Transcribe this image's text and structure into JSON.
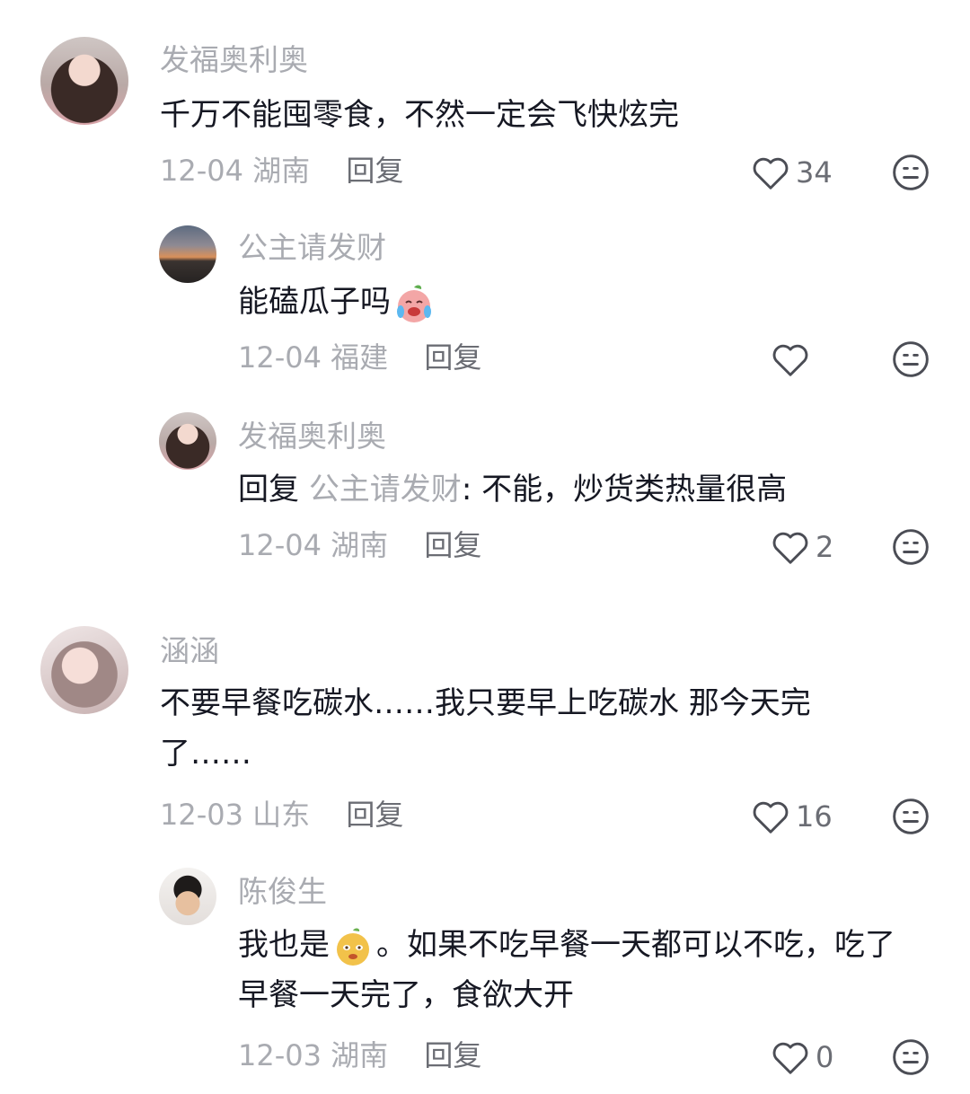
{
  "comments": [
    {
      "name": "发福奥利奥",
      "text": "千万不能囤零食，不然一定会飞快炫完",
      "date": "12-04",
      "location": "湖南",
      "reply_label": "回复",
      "likes": "34"
    },
    {
      "name": "公主请发财",
      "text": "能磕瓜子吗",
      "emoji": "laughing-tears-emoji",
      "date": "12-04",
      "location": "福建",
      "reply_label": "回复",
      "likes": ""
    },
    {
      "name": "发福奥利奥",
      "reply_prefix": "回复 ",
      "mention": "公主请发财",
      "text": ": 不能，炒货类热量很高",
      "date": "12-04",
      "location": "湖南",
      "reply_label": "回复",
      "likes": "2"
    },
    {
      "name": "涵涵",
      "text": "不要早餐吃碳水……我只要早上吃碳水 那今天完了……",
      "date": "12-03",
      "location": "山东",
      "reply_label": "回复",
      "likes": "16"
    },
    {
      "name": "陈俊生",
      "text_before": "我也是",
      "emoji": "smug-face-emoji",
      "text_after": "。如果不吃早餐一天都可以不吃，吃了早餐一天完了，食欲大开",
      "date": "12-03",
      "location": "湖南",
      "reply_label": "回复",
      "likes": "0"
    }
  ],
  "icons": {
    "like": "heart-outline-icon",
    "dislike": "neutral-face-icon"
  },
  "colors": {
    "text": "#161823",
    "muted": "#a9abb1",
    "reply": "#6b6d74"
  }
}
